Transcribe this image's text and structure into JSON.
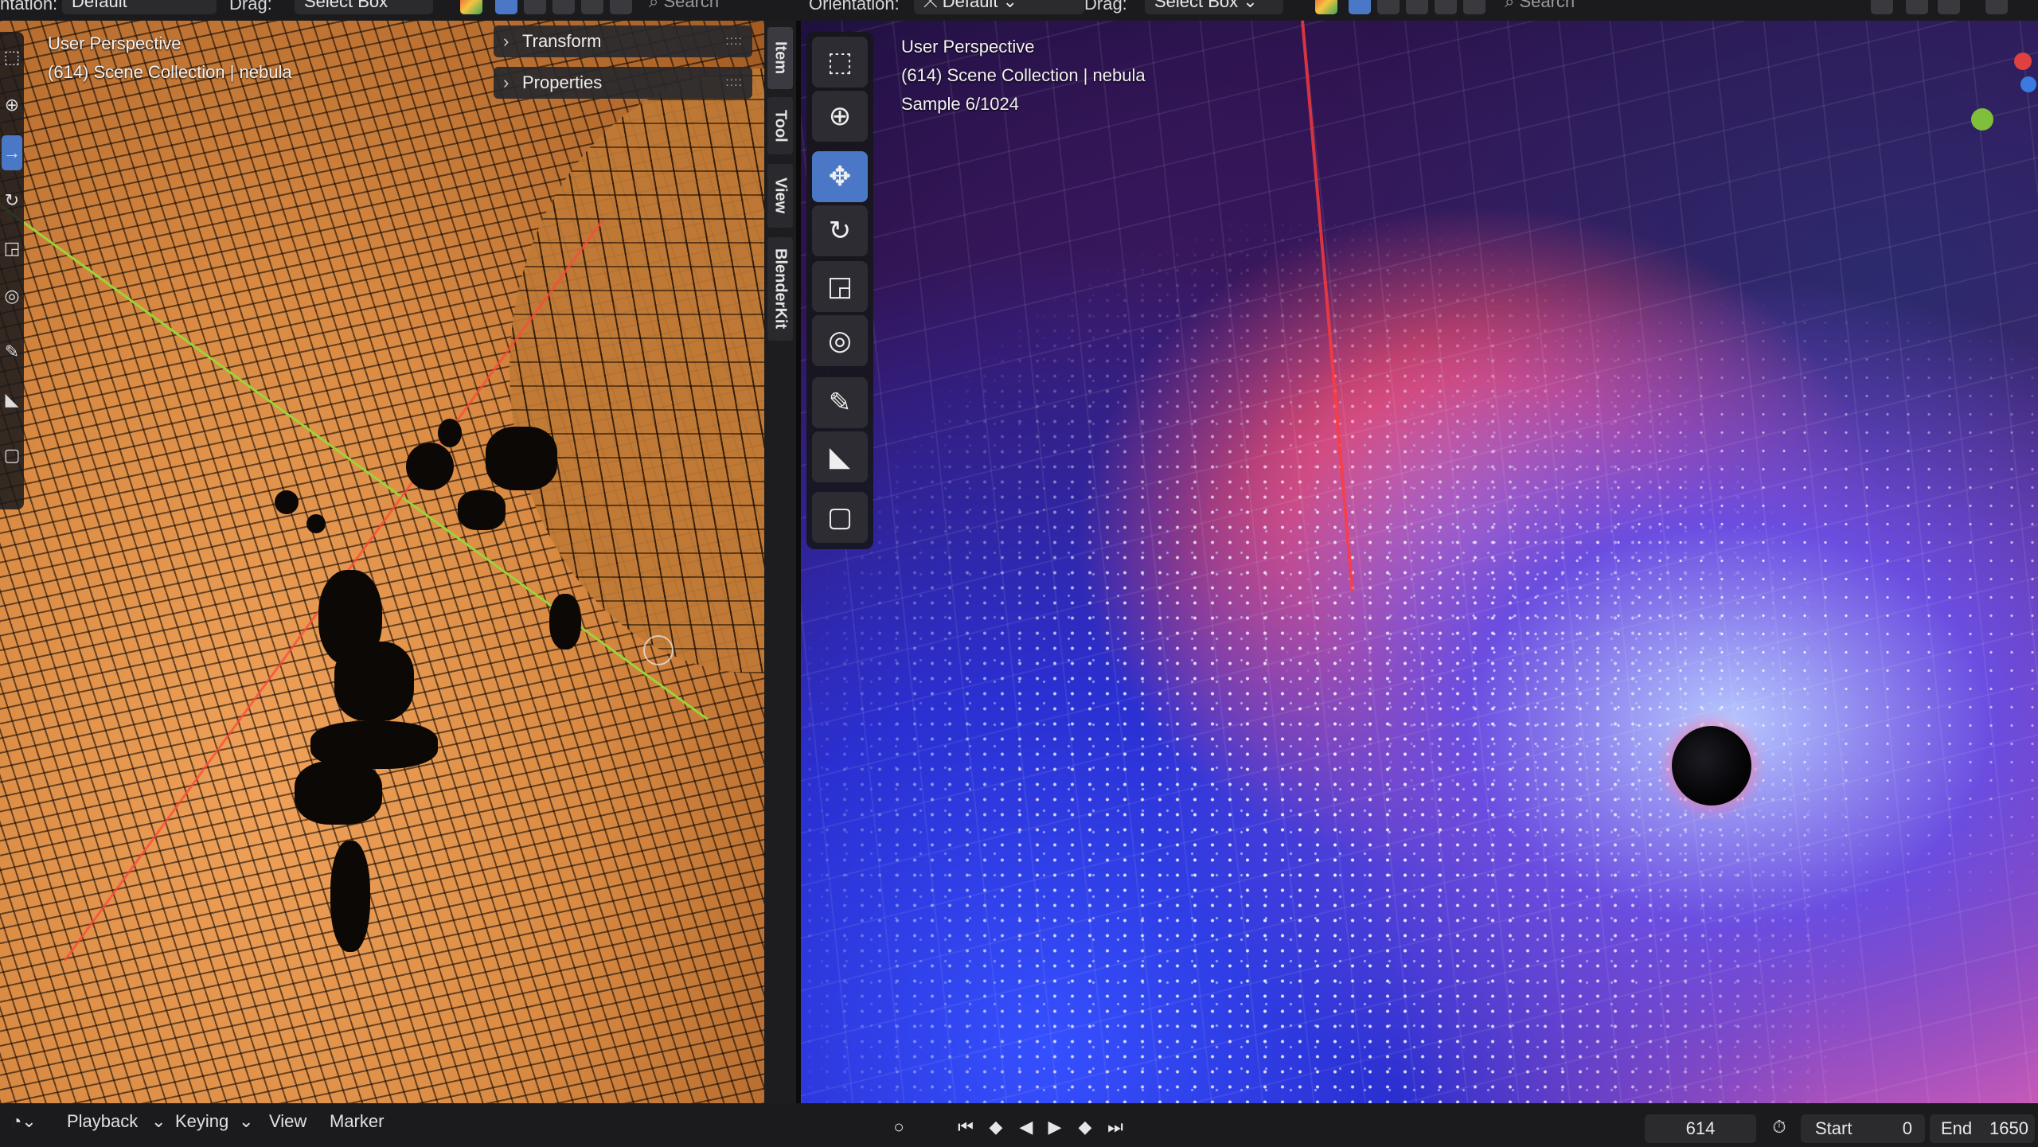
{
  "header_left": {
    "orientation_label": "ntation:",
    "orientation_value": "Default",
    "drag_label": "Drag:",
    "drag_value": "Select Box",
    "search_placeholder": "Search"
  },
  "header_right": {
    "orientation_label": "Orientation:",
    "orientation_value": "Default",
    "drag_label": "Drag:",
    "drag_value": "Select Box",
    "search_placeholder": "Search"
  },
  "left_viewport": {
    "view_name": "User Perspective",
    "collection": "(614) Scene Collection | nebula"
  },
  "n_panel": {
    "sections": [
      {
        "label": "Transform"
      },
      {
        "label": "Properties"
      }
    ],
    "tabs": [
      "Item",
      "Tool",
      "View",
      "BlenderKit"
    ]
  },
  "right_viewport": {
    "view_name": "User Perspective",
    "collection": "(614) Scene Collection | nebula",
    "sample": "Sample 6/1024"
  },
  "timeline": {
    "menus": [
      "Playback",
      "Keying",
      "View",
      "Marker"
    ],
    "current_frame": "614",
    "start_label": "Start",
    "start_value": "0",
    "end_label": "End",
    "end_value": "1650"
  },
  "colors": {
    "accent": "#4a78c7",
    "panel": "#2b2b2e",
    "x_axis": "#ff3b3b",
    "y_axis": "#9bd43a"
  }
}
